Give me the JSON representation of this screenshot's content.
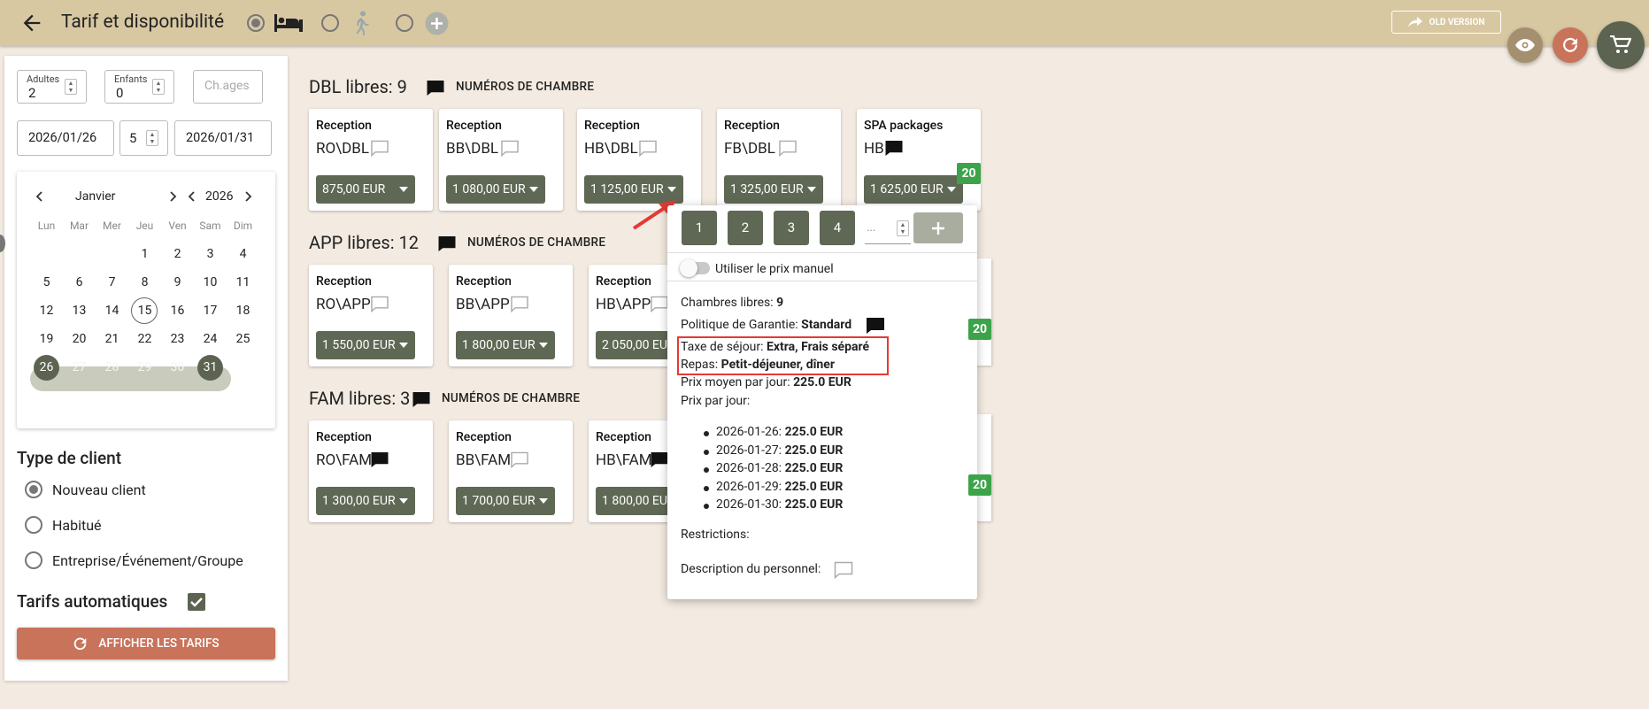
{
  "header": {
    "title": "Tarif et disponibilité",
    "old_version": "OLD VERSION"
  },
  "left": {
    "adults_label": "Adultes",
    "adults": "2",
    "children_label": "Enfants",
    "children": "0",
    "child_ages_placeholder": "Ch.ages",
    "date_from": "2026/01/26",
    "nights": "5",
    "date_to": "2026/01/31",
    "calendar": {
      "month": "Janvier",
      "year": "2026",
      "weekdays": [
        "Lun",
        "Mar",
        "Mer",
        "Jeu",
        "Ven",
        "Sam",
        "Dim"
      ],
      "weeks": [
        [
          "",
          "",
          "",
          "1",
          "2",
          "3",
          "4"
        ],
        [
          "5",
          "6",
          "7",
          "8",
          "9",
          "10",
          "11"
        ],
        [
          "12",
          "13",
          "14",
          "15",
          "16",
          "17",
          "18"
        ],
        [
          "19",
          "20",
          "21",
          "22",
          "23",
          "24",
          "25"
        ],
        [
          "26",
          "27",
          "28",
          "29",
          "30",
          "31",
          ""
        ]
      ],
      "today": "15",
      "range_start": "26",
      "range_end": "31"
    },
    "client_type_title": "Type de client",
    "client_types": [
      "Nouveau client",
      "Habitué",
      "Entreprise/Événement/Groupe"
    ],
    "auto_rates": "Tarifs automatiques",
    "show_rates": "AFFICHER LES TARIFS"
  },
  "sections": [
    {
      "title": "DBL libres: 9",
      "rooms_label": "NUMÉROS DE CHAMBRE",
      "cards": [
        {
          "label": "Reception",
          "name": "RO\\DBL",
          "price": "875,00 EUR"
        },
        {
          "label": "Reception",
          "name": "BB\\DBL",
          "price": "1 080,00 EUR"
        },
        {
          "label": "Reception",
          "name": "HB\\DBL",
          "price": "1 125,00 EUR"
        },
        {
          "label": "Reception",
          "name": "FB\\DBL",
          "price": "1 325,00 EUR"
        },
        {
          "label": "SPA packages",
          "name": "HB",
          "price": "1 625,00 EUR",
          "badge": "20"
        }
      ]
    },
    {
      "title": "APP libres: 12",
      "rooms_label": "NUMÉROS DE CHAMBRE",
      "cards": [
        {
          "label": "Reception",
          "name": "RO\\APP",
          "price": "1 550,00 EUR"
        },
        {
          "label": "Reception",
          "name": "BB\\APP",
          "price": "1 800,00 EUR"
        },
        {
          "label": "Reception",
          "name": "HB\\APP",
          "price": "2 050,00 EUR"
        }
      ],
      "hidden_badge": "20"
    },
    {
      "title": "FAM libres: 3",
      "rooms_label": "NUMÉROS DE CHAMBRE",
      "cards": [
        {
          "label": "Reception",
          "name": "RO\\FAM",
          "price": "1 300,00 EUR"
        },
        {
          "label": "Reception",
          "name": "BB\\FAM",
          "price": "1 700,00 EUR"
        },
        {
          "label": "Reception",
          "name": "HB\\FAM",
          "price": "1 800,00 EUR"
        }
      ],
      "hidden_badge": "20"
    }
  ],
  "popover": {
    "qty_buttons": [
      "1",
      "2",
      "3",
      "4"
    ],
    "qty_placeholder": "...",
    "manual_price": "Utiliser le prix manuel",
    "free_rooms_label": "Chambres libres:",
    "free_rooms": "9",
    "guarantee_label": "Politique de Garantie:",
    "guarantee": "Standard",
    "tax_label": "Taxe de séjour:",
    "tax": "Extra, Frais séparé",
    "meals_label": "Repas:",
    "meals": "Petit-déjeuner, dîner",
    "avg_label": "Prix moyen par jour:",
    "avg": "225.0 EUR",
    "per_day_label": "Prix par jour:",
    "per_day": [
      {
        "date": "2026-01-26:",
        "price": "225.0 EUR"
      },
      {
        "date": "2026-01-27:",
        "price": "225.0 EUR"
      },
      {
        "date": "2026-01-28:",
        "price": "225.0 EUR"
      },
      {
        "date": "2026-01-29:",
        "price": "225.0 EUR"
      },
      {
        "date": "2026-01-30:",
        "price": "225.0 EUR"
      }
    ],
    "restrictions_label": "Restrictions:",
    "staff_desc_label": "Description du personnel:"
  },
  "colors": {
    "header": "#d8c8a2",
    "background": "#f3ebe1",
    "button": "#5f6854",
    "accent": "#c9735a",
    "badge": "#3da34a",
    "eye_fab": "#a48f6f",
    "refresh_fab": "#c9735a",
    "cart_fab": "#5c6451"
  }
}
